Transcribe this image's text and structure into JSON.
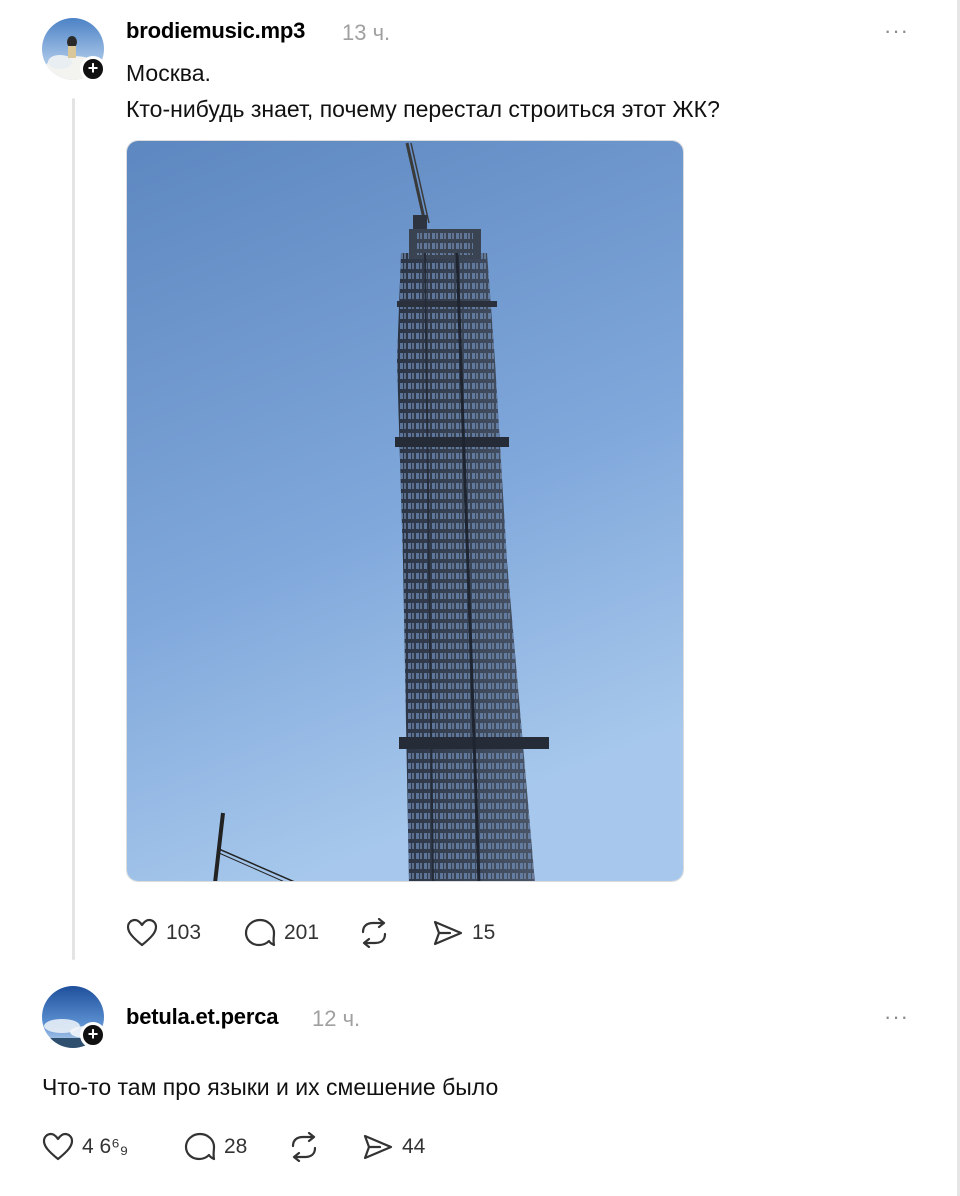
{
  "post": {
    "username": "brodiemusic.mp3",
    "time": "13 ч.",
    "more": "···",
    "line1": "Москва.",
    "line2": "Кто-нибудь знает, почему перестал строиться этот ЖК?",
    "image_alt": "Недостроенный небоскрёб с краном на вершине на фоне голубого неба",
    "actions": {
      "likes": "103",
      "comments": "201",
      "repost_icon": "repost-icon",
      "shares": "15"
    }
  },
  "reply": {
    "username": "betula.et.perca",
    "time": "12 ч.",
    "more": "···",
    "text": "Что-то там про языки и их смешение было",
    "actions": {
      "likes": "4 6⁶₉",
      "comments": "28",
      "repost_icon": "repost-icon",
      "shares": "44"
    }
  },
  "colors": {
    "text": "#111111",
    "muted": "#a0a0a0",
    "divider": "#e4e4e4",
    "sky_top": "#5d87c0",
    "sky_bottom": "#a7c8ec"
  }
}
